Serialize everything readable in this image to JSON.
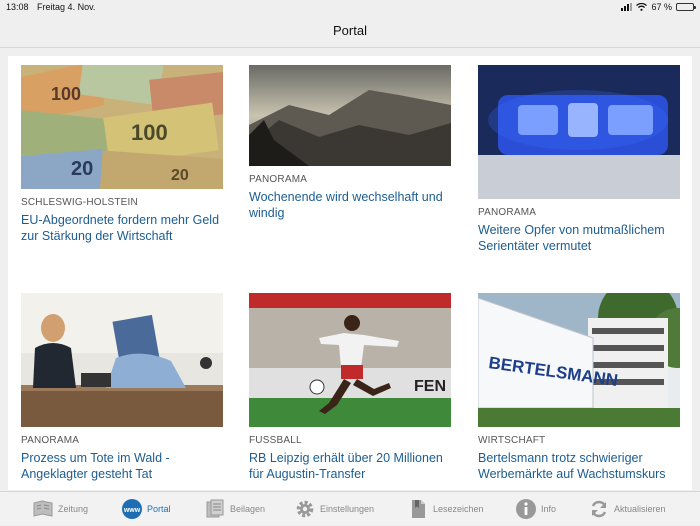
{
  "status_bar": {
    "time": "13:08",
    "date": "Freitag 4. Nov.",
    "battery_percent": "67 %",
    "battery_level": 0.67
  },
  "navbar": {
    "title": "Portal"
  },
  "articles": [
    {
      "category": "SCHLESWIG-HOLSTEIN",
      "headline": "EU-Abgeordnete fordern mehr Geld zur Stärkung der Wirtschaft",
      "image": "euro-banknotes"
    },
    {
      "category": "PANORAMA",
      "headline": "Wochenende wird wechselhaft und windig",
      "image": "misty-mountain-landscape"
    },
    {
      "category": "PANORAMA",
      "headline": "Weitere Opfer von mutmaßlichem Serientäter vermutet",
      "image": "police-blue-light"
    },
    {
      "category": "PANORAMA",
      "headline": "Prozess um Tote im Wald - Angeklagter gesteht Tat",
      "image": "courtroom"
    },
    {
      "category": "FUSSBALL",
      "headline": "RB Leipzig erhält über 20 Millionen für Augustin-Transfer",
      "image": "football-player"
    },
    {
      "category": "WIRTSCHAFT",
      "headline": "Bertelsmann trotz schwieriger Werbemärkte auf Wachstumskurs",
      "image": "bertelsmann-building"
    }
  ],
  "bertelsmann_sign": "BERTELSMANN",
  "tabbar": {
    "items": [
      {
        "label": "Zeitung",
        "icon": "newspaper-icon"
      },
      {
        "label": "Portal",
        "icon": "www-icon",
        "active": true
      },
      {
        "label": "Beilagen",
        "icon": "supplements-icon"
      },
      {
        "label": "Einstellungen",
        "icon": "gear-icon"
      },
      {
        "label": "Lesezeichen",
        "icon": "bookmark-icon"
      },
      {
        "label": "Info",
        "icon": "info-icon"
      },
      {
        "label": "Aktualisieren",
        "icon": "refresh-icon"
      }
    ]
  },
  "colors": {
    "accent": "#1f6eb4",
    "headline": "#1c5d91",
    "inactive": "#888888"
  }
}
